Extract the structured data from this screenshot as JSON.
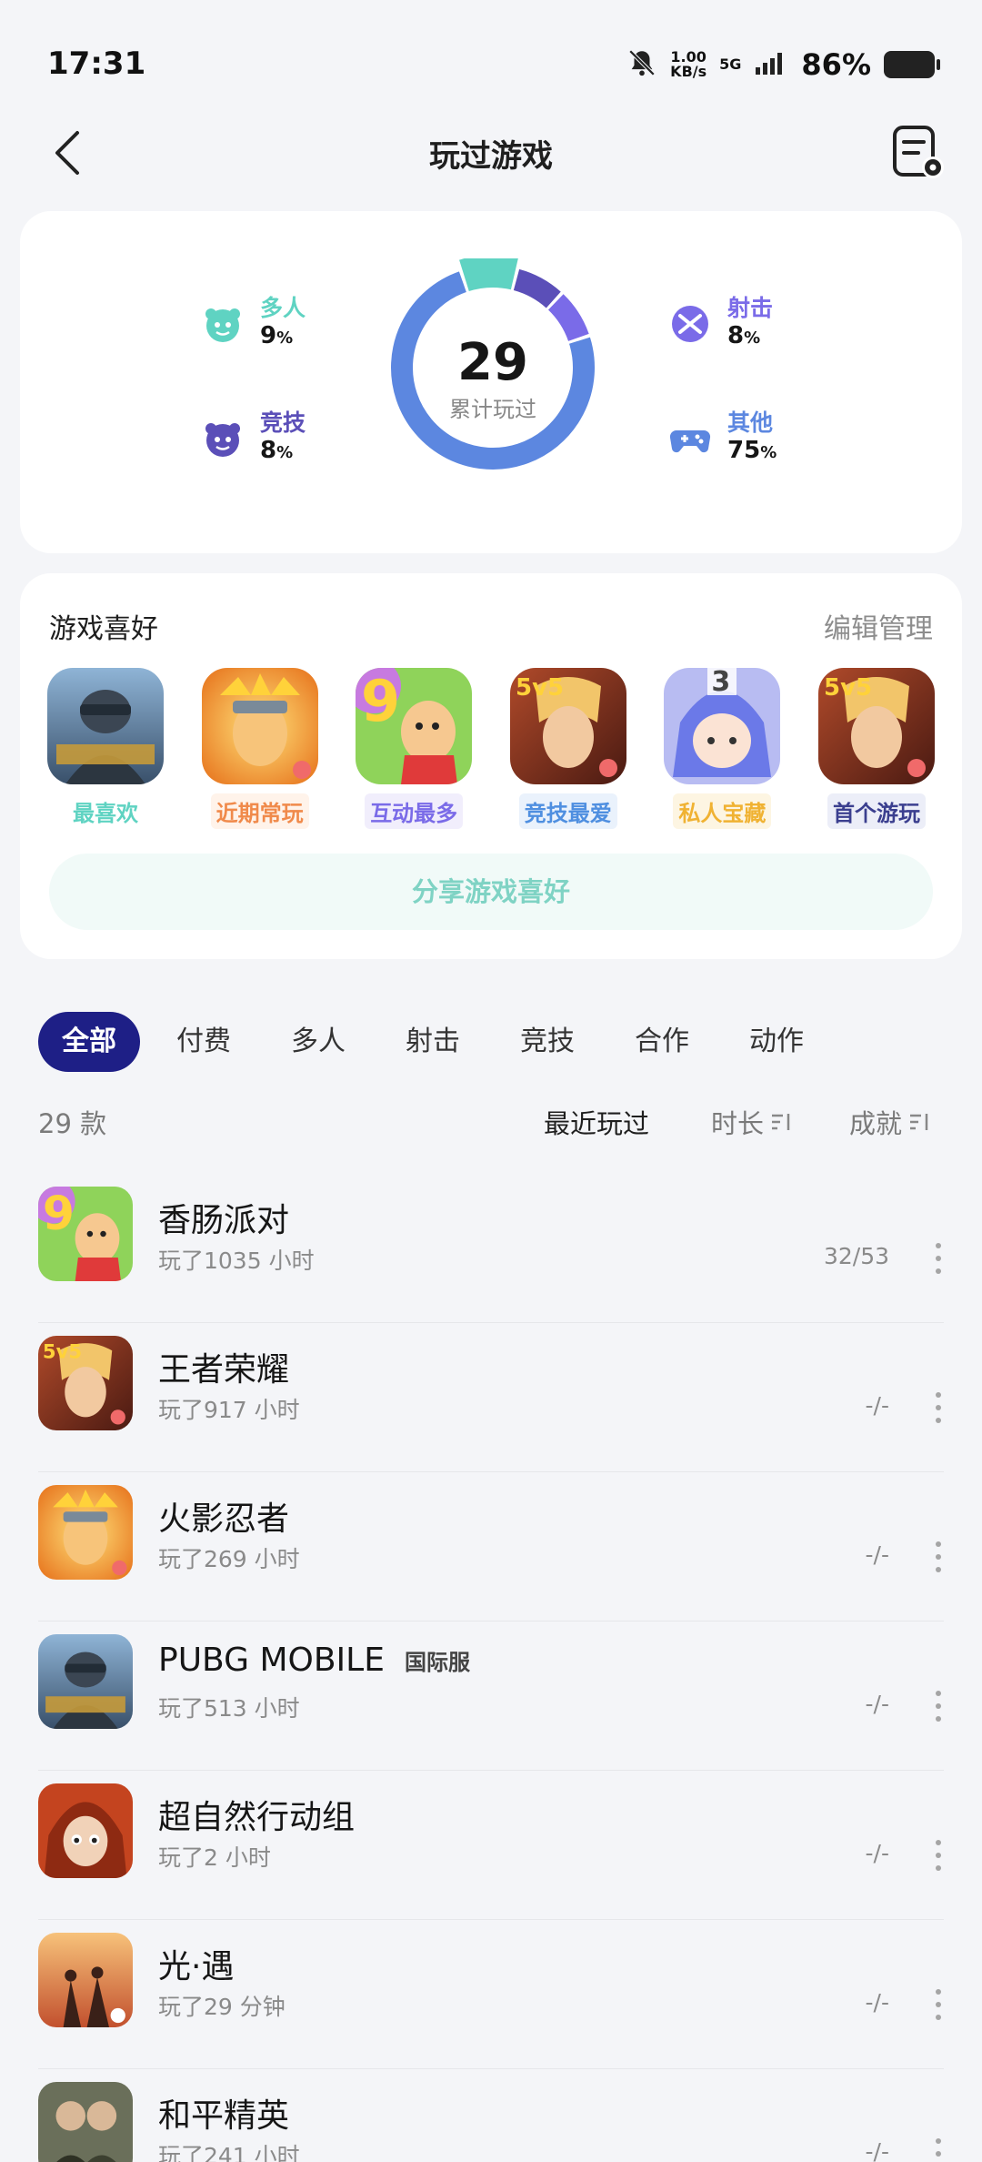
{
  "status": {
    "time": "17:31",
    "speed_top": "1.00",
    "speed_bottom": "KB/s",
    "network": "5G",
    "battery": "86%"
  },
  "nav": {
    "title": "玩过游戏"
  },
  "stats": {
    "total": "29",
    "total_label": "累计玩过",
    "segments": [
      {
        "name": "多人",
        "value": 9,
        "color": "#5fd3c2"
      },
      {
        "name": "竞技",
        "value": 8,
        "color": "#5b4fb8"
      },
      {
        "name": "射击",
        "value": 8,
        "color": "#7a6be8"
      },
      {
        "name": "其他",
        "value": 75,
        "color": "#5c87e0"
      }
    ],
    "items": [
      {
        "label": "多人",
        "value": "9",
        "unit": "%",
        "color": "#5fd3c2"
      },
      {
        "label": "竞技",
        "value": "8",
        "unit": "%",
        "color": "#5b4fb8"
      },
      {
        "label": "射击",
        "value": "8",
        "unit": "%",
        "color": "#7a6be8"
      },
      {
        "label": "其他",
        "value": "75",
        "unit": "%",
        "color": "#5c87e0"
      }
    ]
  },
  "preferences": {
    "title": "游戏喜好",
    "edit_label": "编辑管理",
    "share_label": "分享游戏喜好",
    "games": [
      {
        "tag": "最喜欢",
        "tag_color": "#5fd3c2",
        "tag_bg": "#ffffff",
        "icon": "pubg-icon"
      },
      {
        "tag": "近期常玩",
        "tag_color": "#f08a4b",
        "tag_bg": "#fff3ea",
        "icon": "naruto-icon"
      },
      {
        "tag": "互动最多",
        "tag_color": "#7a6be8",
        "tag_bg": "#f1eefc",
        "icon": "sausage-party-icon"
      },
      {
        "tag": "竞技最爱",
        "tag_color": "#4f8fe0",
        "tag_bg": "#eaf2fc",
        "icon": "honor-of-kings-icon"
      },
      {
        "tag": "私人宝藏",
        "tag_color": "#f0b232",
        "tag_bg": "#fdf5e2",
        "icon": "anime-girl-icon"
      },
      {
        "tag": "首个游玩",
        "tag_color": "#3b3f8f",
        "tag_bg": "#eceef8",
        "icon": "honor-of-kings-icon"
      }
    ],
    "badge_number": "3"
  },
  "filters": {
    "tabs": [
      "全部",
      "付费",
      "多人",
      "射击",
      "竞技",
      "合作",
      "动作"
    ],
    "active": 0
  },
  "list_header": {
    "count": "29 款",
    "sort_recent": "最近玩过",
    "sort_duration": "时长",
    "sort_achievement": "成就"
  },
  "games": [
    {
      "name": "香肠派对",
      "badge": "",
      "played": "玩了1035 小时",
      "achievement": "32/53",
      "icon": "sausage-party-icon"
    },
    {
      "name": "王者荣耀",
      "badge": "",
      "played": "玩了917 小时",
      "achievement": "-/-",
      "icon": "honor-of-kings-icon"
    },
    {
      "name": "火影忍者",
      "badge": "",
      "played": "玩了269 小时",
      "achievement": "-/-",
      "icon": "naruto-icon"
    },
    {
      "name": "PUBG MOBILE",
      "badge": "国际服",
      "played": "玩了513 小时",
      "achievement": "-/-",
      "icon": "pubg-icon"
    },
    {
      "name": "超自然行动组",
      "badge": "",
      "played": "玩了2 小时",
      "achievement": "-/-",
      "icon": "supernatural-icon"
    },
    {
      "name": "光·遇",
      "badge": "",
      "played": "玩了29 分钟",
      "achievement": "-/-",
      "icon": "sky-icon"
    },
    {
      "name": "和平精英",
      "badge": "",
      "played": "玩了241 小时",
      "achievement": "-/-",
      "icon": "peace-elite-icon"
    }
  ]
}
